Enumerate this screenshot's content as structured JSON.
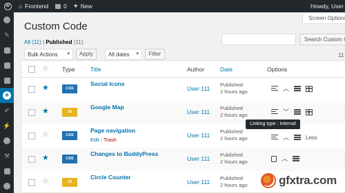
{
  "adminbar": {
    "site_name": "Frontend",
    "comments_count": "0",
    "new_label": "New",
    "howdy": "Howdy, User"
  },
  "header": {
    "title": "Custom Code",
    "screen_options": "Screen Options"
  },
  "filters": {
    "all": "All",
    "all_count": "(11)",
    "separator": "|",
    "published": "Published",
    "published_count": "(11)"
  },
  "search": {
    "button": "Search Custom Code",
    "placeholder": ""
  },
  "toolbar": {
    "bulk_actions": "Bulk Actions",
    "apply": "Apply",
    "all_dates": "All dates",
    "filter": "Filter",
    "items_count": "11"
  },
  "columns": {
    "type": "Type",
    "title": "Title",
    "author": "Author",
    "date": "Date",
    "options": "Options"
  },
  "rows": [
    {
      "type": "CSS",
      "title": "Social Icons",
      "author": "User 111",
      "status": "Published",
      "time": "2 hours ago",
      "starred": true
    },
    {
      "type": "JS",
      "title": "Google Map",
      "author": "User 111",
      "status": "Published",
      "time": "2 hours ago",
      "starred": true
    },
    {
      "type": "CSS",
      "title": "Page navigation",
      "author": "User 111",
      "status": "Published",
      "time": "2 hours ago",
      "starred": false,
      "edit": "Edit",
      "trash": "Trash",
      "less": "Less"
    },
    {
      "type": "CSS",
      "title": "Changes to BuddyPress",
      "author": "User 111",
      "status": "Published",
      "time": "2 hours ago",
      "starred": true
    },
    {
      "type": "JS",
      "title": "Circle Counter",
      "author": "User 111",
      "status": "Published",
      "time": "2 hours ago",
      "starred": false
    }
  ],
  "tooltip": "Linking type : Internal",
  "watermark": "gfxtra.com",
  "colors": {
    "accent": "#0073aa",
    "css_badge": "#2271b1",
    "js_badge": "#e8b321",
    "adminbar": "#23282d",
    "trash": "#aa0000"
  }
}
